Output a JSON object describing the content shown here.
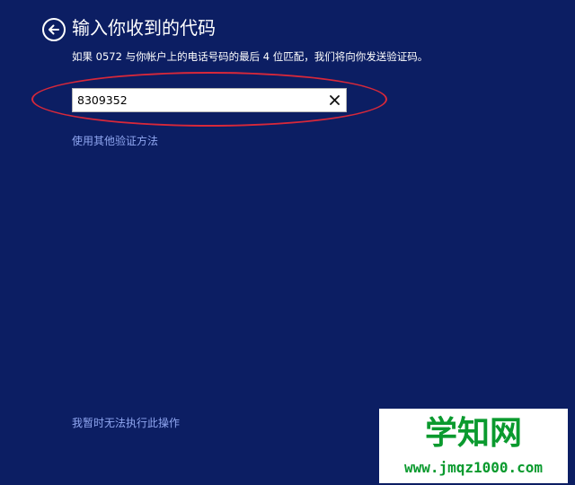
{
  "header": {
    "back_icon": "arrow-left-circle-icon",
    "title": "输入你收到的代码"
  },
  "description": "如果 0572 与你帐户上的电话号码的最后 4 位匹配，我们将向你发送验证码。",
  "code_field": {
    "value": "8309352",
    "clear_icon": "close-x-icon"
  },
  "links": {
    "alternate_method": "使用其他验证方法",
    "cannot_now": "我暂时无法执行此操作"
  },
  "watermark": {
    "brand": "学知网",
    "url": "www.jmqz1000.com"
  },
  "colors": {
    "background": "#0c1e63",
    "link": "#8fa6f0",
    "highlight": "#d7283a",
    "watermark": "#0a9a2e"
  }
}
